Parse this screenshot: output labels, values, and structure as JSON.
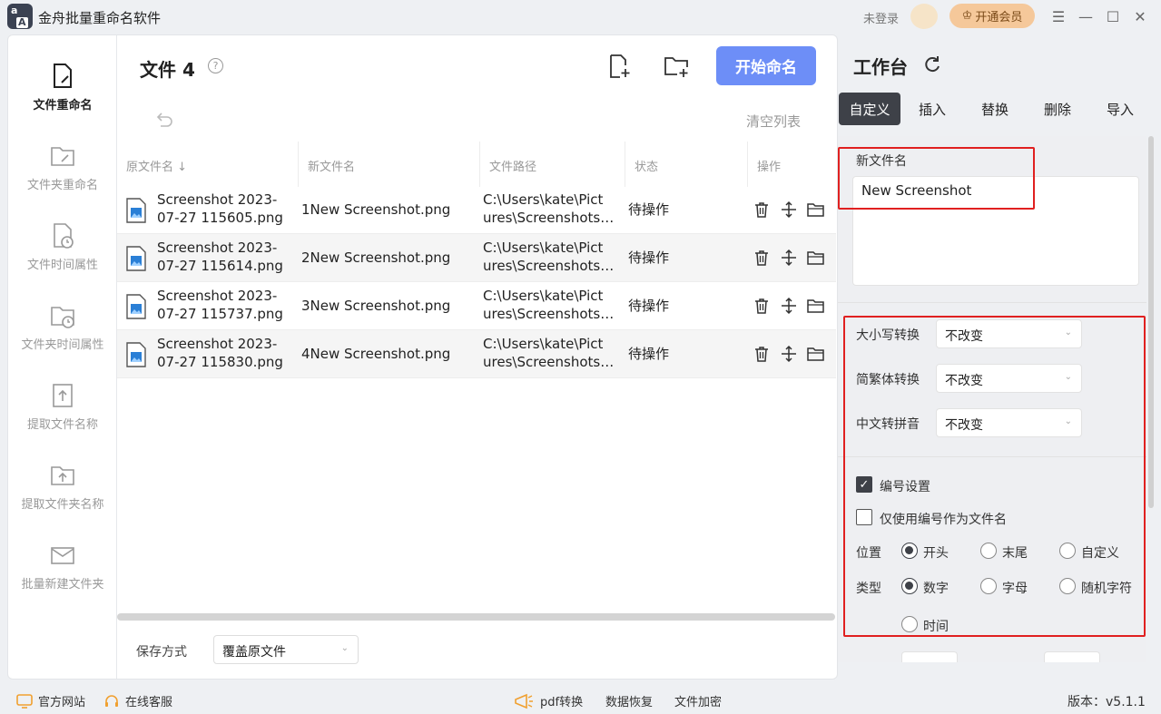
{
  "app": {
    "title": "金舟批量重命名软件",
    "login": "未登录",
    "vip_button": "开通会员"
  },
  "sidebar": {
    "items": [
      {
        "label": "文件重命名",
        "icon": "file-edit-icon",
        "active": true
      },
      {
        "label": "文件夹重命名",
        "icon": "folder-edit-icon",
        "active": false
      },
      {
        "label": "文件时间属性",
        "icon": "file-clock-icon",
        "active": false
      },
      {
        "label": "文件夹时间属性",
        "icon": "folder-clock-icon",
        "active": false
      },
      {
        "label": "提取文件名称",
        "icon": "file-extract-icon",
        "active": false
      },
      {
        "label": "提取文件夹名称",
        "icon": "folder-extract-icon",
        "active": false
      },
      {
        "label": "批量新建文件夹",
        "icon": "batch-folder-icon",
        "active": false
      }
    ]
  },
  "files": {
    "title": "文件 4",
    "start_button": "开始命名",
    "clear_list": "清空列表",
    "columns": [
      "原文件名",
      "新文件名",
      "文件路径",
      "状态",
      "操作"
    ],
    "rows": [
      {
        "orig": [
          "Screenshot 2023-",
          "07-27 115605.png"
        ],
        "new": "1New Screenshot.png",
        "path": [
          "C:\\Users\\kate\\Pict",
          "ures\\Screenshots\\..."
        ],
        "status": "待操作"
      },
      {
        "orig": [
          "Screenshot 2023-",
          "07-27 115614.png"
        ],
        "new": "2New Screenshot.png",
        "path": [
          "C:\\Users\\kate\\Pict",
          "ures\\Screenshots\\..."
        ],
        "status": "待操作"
      },
      {
        "orig": [
          "Screenshot 2023-",
          "07-27 115737.png"
        ],
        "new": "3New Screenshot.png",
        "path": [
          "C:\\Users\\kate\\Pict",
          "ures\\Screenshots\\..."
        ],
        "status": "待操作"
      },
      {
        "orig": [
          "Screenshot 2023-",
          "07-27 115830.png"
        ],
        "new": "4New Screenshot.png",
        "path": [
          "C:\\Users\\kate\\Pict",
          "ures\\Screenshots\\..."
        ],
        "status": "待操作"
      }
    ],
    "save_label": "保存方式",
    "save_value": "覆盖原文件"
  },
  "workspace": {
    "title": "工作台",
    "tabs": [
      "自定义",
      "插入",
      "替换",
      "删除",
      "导入"
    ],
    "new_name_label": "新文件名",
    "new_name_value": "New Screenshot",
    "case_label": "大小写转换",
    "case_value": "不改变",
    "trad_label": "简繁体转换",
    "trad_value": "不改变",
    "pinyin_label": "中文转拼音",
    "pinyin_value": "不改变",
    "numbering_label": "编号设置",
    "numbering_checked": true,
    "only_number_label": "仅使用编号作为文件名",
    "only_number_checked": false,
    "position_label": "位置",
    "position_options": [
      "开头",
      "末尾",
      "自定义"
    ],
    "position_selected": "开头",
    "type_label": "类型",
    "type_options": [
      "数字",
      "字母",
      "随机字符",
      "时间"
    ],
    "type_selected": "数字"
  },
  "bottom": {
    "website": "官方网站",
    "support": "在线客服",
    "pdf": "pdf转换",
    "recovery": "数据恢复",
    "encrypt": "文件加密",
    "version": "版本：v5.1.1"
  },
  "colors": {
    "accent": "#6d8ef7",
    "dark_tab": "#3e4148",
    "highlight_box": "#e02020",
    "vip": "#f5c89a"
  }
}
